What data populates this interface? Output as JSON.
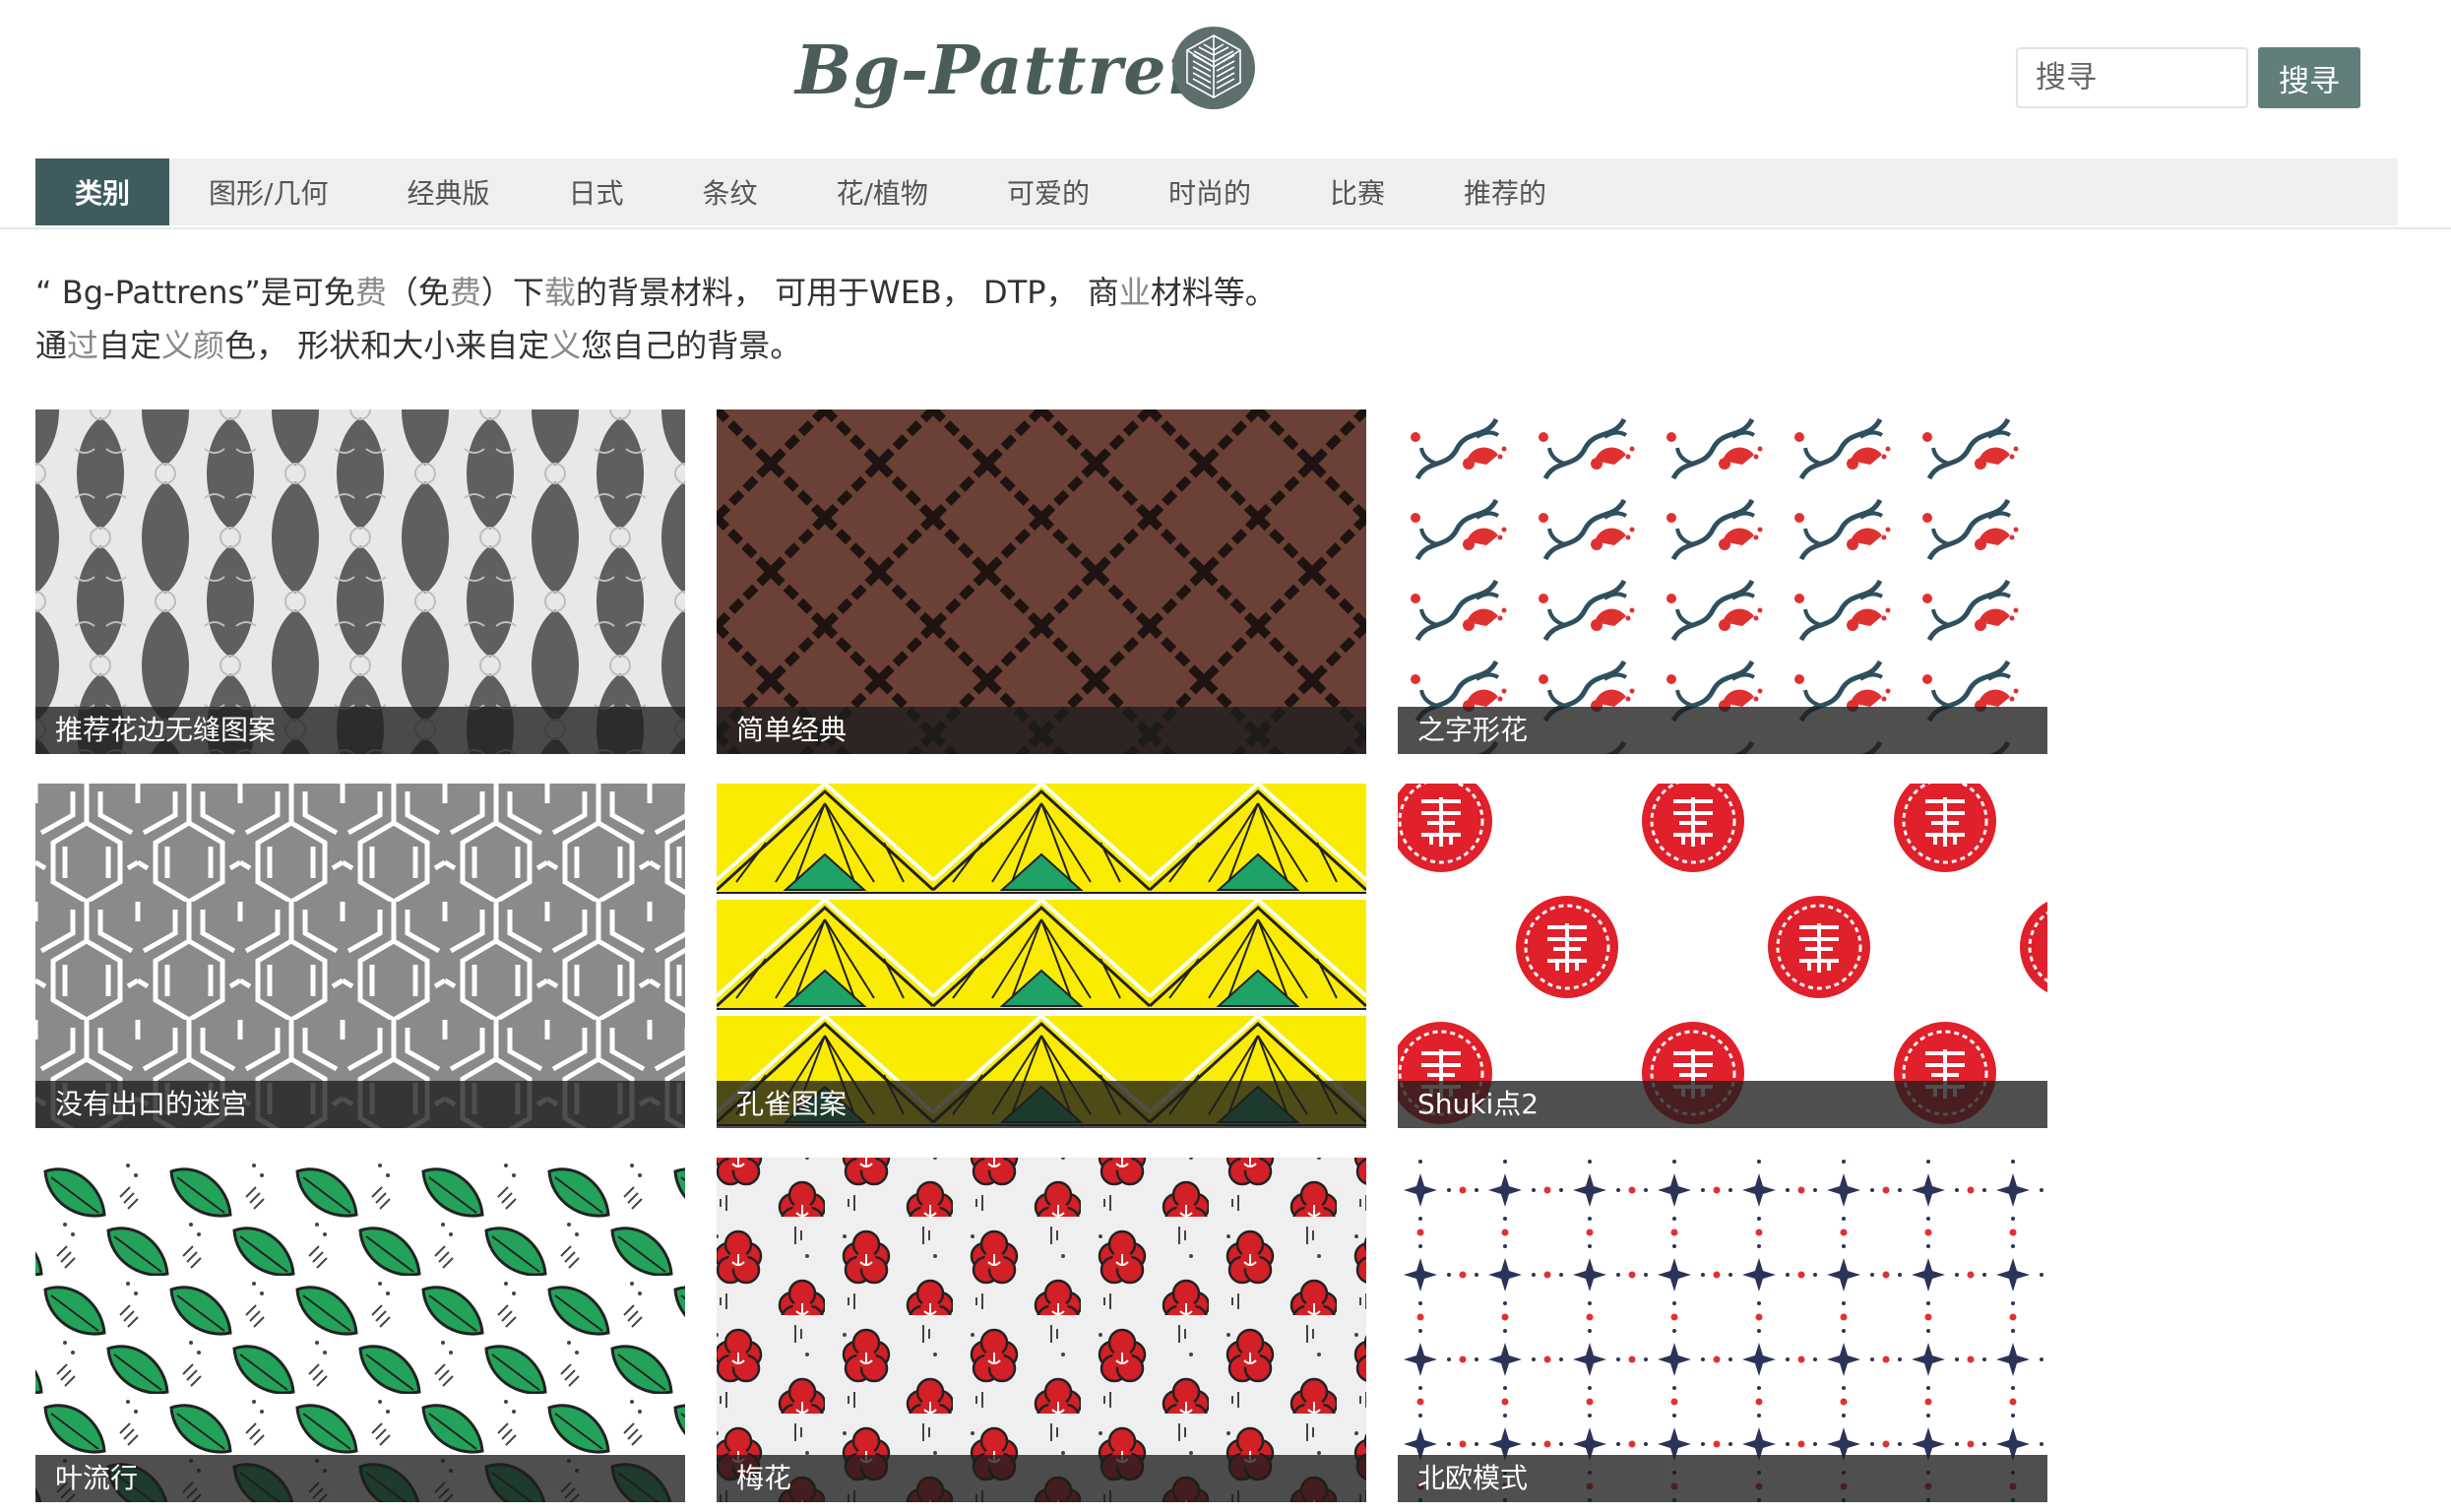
{
  "header": {
    "logo_text": "Bg-Pattrens",
    "logo_icon": "cube-pattern-icon"
  },
  "search": {
    "placeholder": "搜寻",
    "button_label": "搜寻"
  },
  "nav": {
    "items": [
      {
        "label": "类别",
        "active": true
      },
      {
        "label": "图形/几何"
      },
      {
        "label": "经典版"
      },
      {
        "label": "日式"
      },
      {
        "label": "条纹"
      },
      {
        "label": "花/植物"
      },
      {
        "label": "可爱的"
      },
      {
        "label": "时尚的"
      },
      {
        "label": "比赛"
      },
      {
        "label": "推荐的"
      }
    ]
  },
  "intro": {
    "line1_a": "“ Bg-Pattrens”是可免",
    "line1_b": "费",
    "line1_c": "（免",
    "line1_d": "费",
    "line1_e": "）下",
    "line1_f": "载",
    "line1_g": "的背景材料， 可用于WEB， DTP， 商",
    "line1_h": "业",
    "line1_i": "材料等。",
    "line2_a": "通",
    "line2_b": "过",
    "line2_c": "自定",
    "line2_d": "义颜",
    "line2_e": "色， 形状和大小来自定",
    "line2_f": "义",
    "line2_g": "您自己的背景。"
  },
  "patterns": [
    {
      "title": "推荐花边无缝图案"
    },
    {
      "title": "简单经典"
    },
    {
      "title": "之字形花"
    },
    {
      "title": "没有出口的迷宫"
    },
    {
      "title": "孔雀图案"
    },
    {
      "title": "Shuki点2"
    },
    {
      "title": "叶流行"
    },
    {
      "title": "梅花"
    },
    {
      "title": "北欧模式"
    }
  ],
  "colors": {
    "nav_active": "#3e5c5e",
    "search_button": "#617e7a",
    "logo": "#4a5d5b"
  }
}
